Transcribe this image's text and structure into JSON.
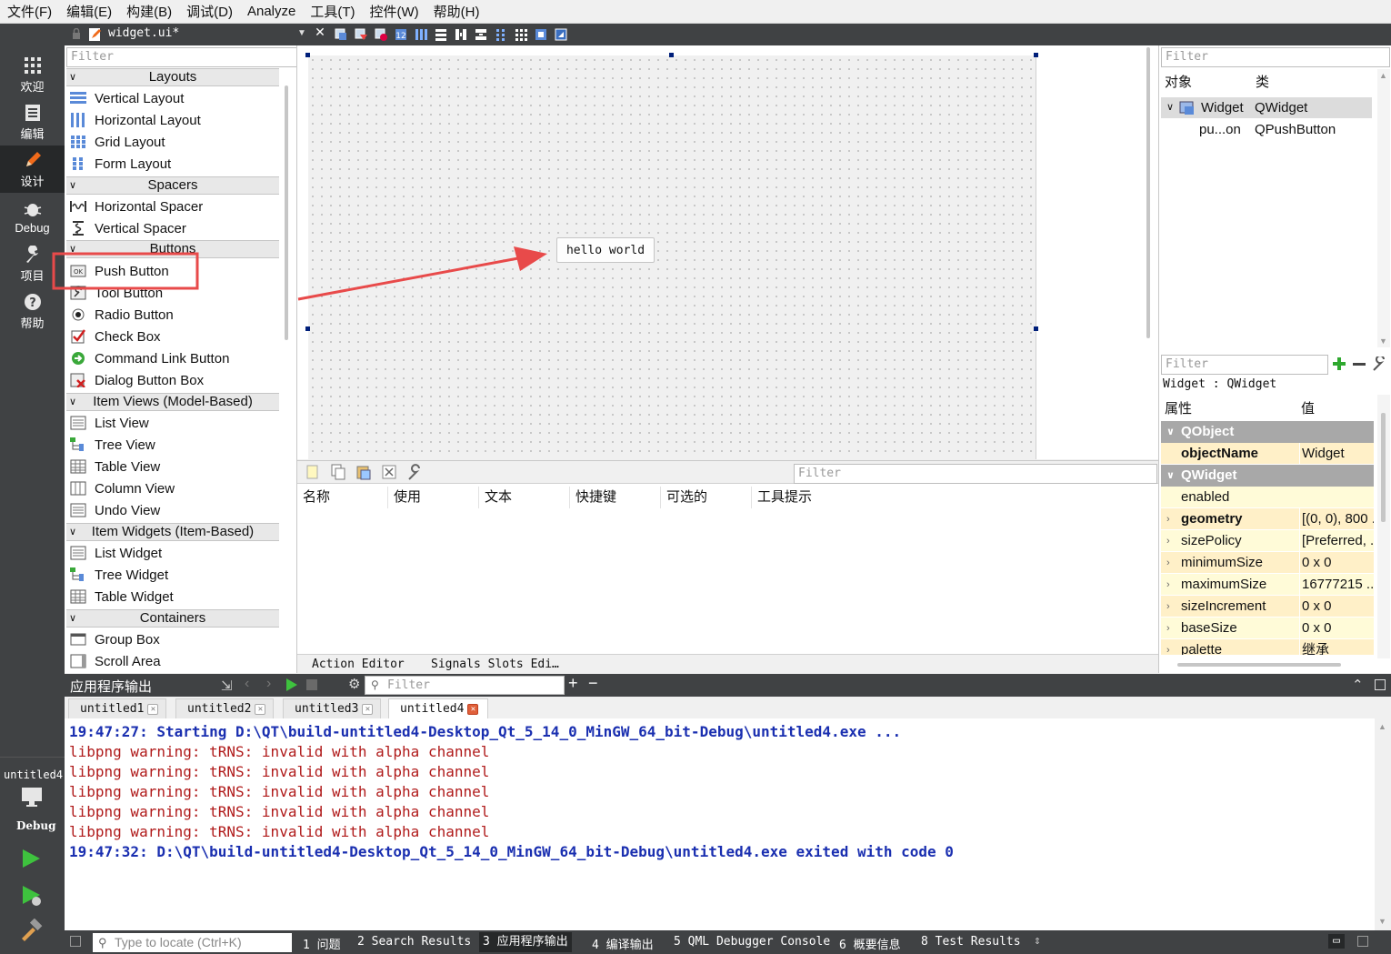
{
  "menu": [
    "文件(F)",
    "编辑(E)",
    "构建(B)",
    "调试(D)",
    "Analyze",
    "工具(T)",
    "控件(W)",
    "帮助(H)"
  ],
  "editor_tab": {
    "filename": "widget.ui*"
  },
  "modes": [
    {
      "label": "欢迎",
      "icon": "grid-icon"
    },
    {
      "label": "编辑",
      "icon": "document-icon"
    },
    {
      "label": "设计",
      "icon": "pencil-icon"
    },
    {
      "label": "Debug",
      "icon": "bug-icon"
    },
    {
      "label": "项目",
      "icon": "wrench-icon"
    },
    {
      "label": "帮助",
      "icon": "help-icon"
    }
  ],
  "kit": {
    "name": "untitled4",
    "mode": "Debug"
  },
  "widgetbox": {
    "filter_placeholder": "Filter",
    "categories": {
      "layouts": "Layouts",
      "spacers": "Spacers",
      "buttons": "Buttons",
      "item_views": "Item Views (Model-Based)",
      "item_widgets": "Item Widgets (Item-Based)",
      "containers": "Containers"
    },
    "items": {
      "vertical_layout": "Vertical Layout",
      "horizontal_layout": "Horizontal Layout",
      "grid_layout": "Grid Layout",
      "form_layout": "Form Layout",
      "horizontal_spacer": "Horizontal Spacer",
      "vertical_spacer": "Vertical Spacer",
      "push_button": "Push Button",
      "tool_button": "Tool Button",
      "radio_button": "Radio Button",
      "check_box": "Check Box",
      "command_link_button": "Command Link Button",
      "dialog_button_box": "Dialog Button Box",
      "list_view": "List View",
      "tree_view": "Tree View",
      "table_view": "Table View",
      "column_view": "Column View",
      "undo_view": "Undo View",
      "list_widget": "List Widget",
      "tree_widget": "Tree Widget",
      "table_widget": "Table Widget",
      "group_box": "Group Box",
      "scroll_area": "Scroll Area"
    }
  },
  "form": {
    "button_text": "hello world"
  },
  "action_editor": {
    "filter_placeholder": "Filter",
    "columns": [
      "名称",
      "使用",
      "文本",
      "快捷键",
      "可选的",
      "工具提示"
    ],
    "tabs": [
      "Action Editor",
      "Signals  Slots Edi…"
    ]
  },
  "object_inspector": {
    "filter_placeholder": "Filter",
    "col_object": "对象",
    "col_class": "类",
    "rows": [
      {
        "object": "Widget",
        "class": "QWidget"
      },
      {
        "object": "pu...on",
        "class": "QPushButton"
      }
    ]
  },
  "property_editor": {
    "filter_placeholder": "Filter",
    "context": "Widget : QWidget",
    "col_property": "属性",
    "col_value": "值",
    "section_qobject": "QObject",
    "section_qwidget": "QWidget",
    "object_name": {
      "name": "objectName",
      "value": "Widget"
    },
    "props": [
      {
        "name": "enabled",
        "value": ""
      },
      {
        "name": "geometry",
        "value": "[(0, 0), 800 ..."
      },
      {
        "name": "sizePolicy",
        "value": "[Preferred, ..."
      },
      {
        "name": "minimumSize",
        "value": "0 x 0"
      },
      {
        "name": "maximumSize",
        "value": "16777215 ..."
      },
      {
        "name": "sizeIncrement",
        "value": "0 x 0"
      },
      {
        "name": "baseSize",
        "value": "0 x 0"
      },
      {
        "name": "palette",
        "value": "继承"
      }
    ]
  },
  "output": {
    "title": "应用程序输出",
    "filter_placeholder": "Filter",
    "tabs": [
      "untitled1",
      "untitled2",
      "untitled3",
      "untitled4"
    ],
    "lines": [
      {
        "text": "19:47:27: Starting D:\\QT\\build-untitled4-Desktop_Qt_5_14_0_MinGW_64_bit-Debug\\untitled4.exe ...",
        "style": "info"
      },
      {
        "text": "libpng warning: tRNS: invalid with alpha channel",
        "style": "warning"
      },
      {
        "text": "libpng warning: tRNS: invalid with alpha channel",
        "style": "warning"
      },
      {
        "text": "libpng warning: tRNS: invalid with alpha channel",
        "style": "warning"
      },
      {
        "text": "libpng warning: tRNS: invalid with alpha channel",
        "style": "warning"
      },
      {
        "text": "libpng warning: tRNS: invalid with alpha channel",
        "style": "warning"
      },
      {
        "text": "19:47:32: D:\\QT\\build-untitled4-Desktop_Qt_5_14_0_MinGW_64_bit-Debug\\untitled4.exe exited with code 0",
        "style": "info"
      }
    ]
  },
  "statusbar": {
    "locate_placeholder": "Type to locate (Ctrl+K)",
    "panes": [
      "1 问题",
      "2 Search Results",
      "3 应用程序输出",
      "4 编译输出",
      "5 QML Debugger Console",
      "6 概要信息",
      "8 Test Results"
    ]
  },
  "colors": {
    "highlight_red": "#e84a4a",
    "dark_bar": "#404244",
    "selection_handle": "#001f7a",
    "info_blue": "#1a2fb0",
    "warning_red": "#b01a1a",
    "check_blue": "#0f5fc8"
  }
}
